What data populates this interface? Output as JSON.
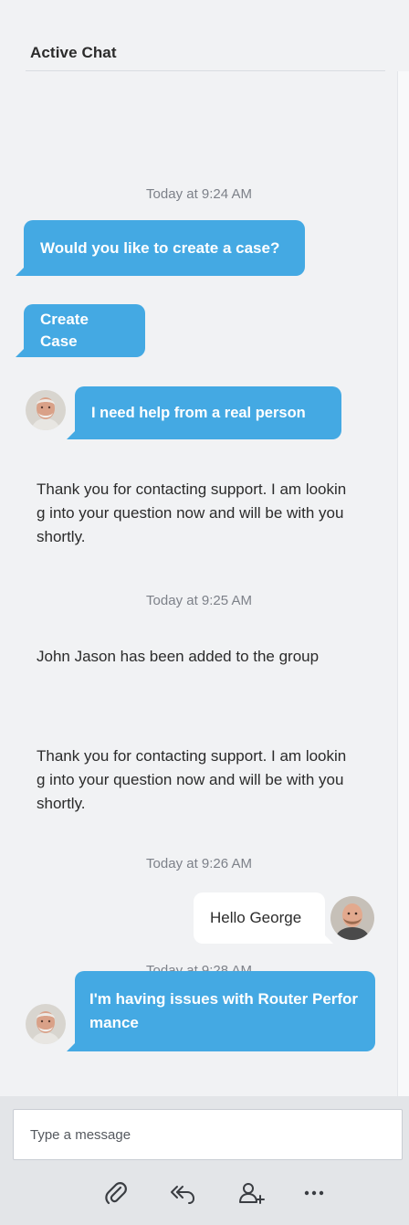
{
  "header": {
    "title": "Active Chat"
  },
  "messages": [
    {
      "type": "timestamp",
      "text": "Today at 9:24 AM"
    },
    {
      "type": "bot",
      "text": "Would you like to create a case?"
    },
    {
      "type": "bot-button",
      "text": "Create Case"
    },
    {
      "type": "customer",
      "avatar": "elderly-man-avatar",
      "text": "I need help from a real person"
    },
    {
      "type": "system",
      "text": "Thank you for contacting support. I am looking into your question now and will be with you shortly."
    },
    {
      "type": "timestamp",
      "text": "Today at 9:25 AM"
    },
    {
      "type": "system",
      "text": "John Jason has been added to the group"
    },
    {
      "type": "system",
      "text": "Thank you for contacting support. I am looking into your question now and will be with you shortly."
    },
    {
      "type": "timestamp",
      "text": "Today at 9:26 AM"
    },
    {
      "type": "agent",
      "avatar": "bald-man-avatar",
      "text": "Hello George"
    },
    {
      "type": "timestamp",
      "text": "Today at 9:28 AM"
    },
    {
      "type": "customer",
      "avatar": "elderly-man-avatar",
      "text": "I'm having issues with Router Performance"
    }
  ],
  "composer": {
    "placeholder": "Type a message",
    "actions": [
      {
        "icon": "paperclip-icon",
        "label": "Attach file"
      },
      {
        "icon": "reply-all-icon",
        "label": "Transfer"
      },
      {
        "icon": "add-person-icon",
        "label": "Add participant"
      },
      {
        "icon": "more-icon",
        "label": "More"
      }
    ]
  },
  "colors": {
    "bubble_blue": "#44a9e3",
    "panel_bg": "#f1f2f4",
    "composer_bg": "#e3e5e8",
    "timestamp_text": "#7d8189"
  }
}
